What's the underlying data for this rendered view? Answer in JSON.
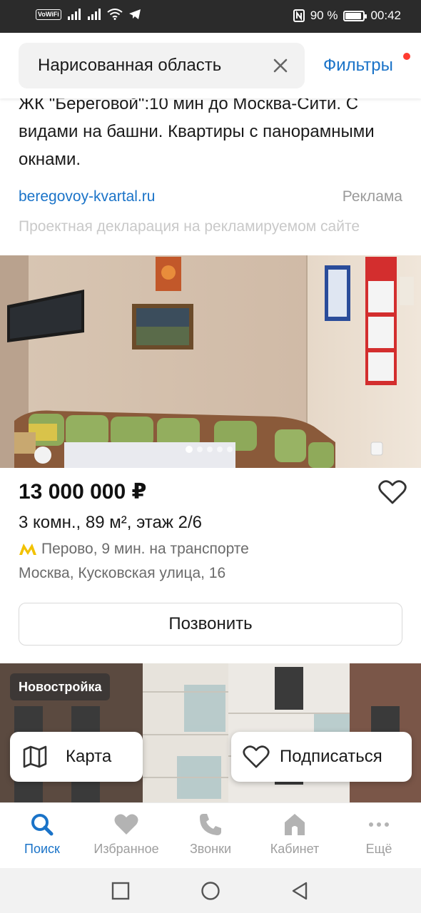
{
  "status_bar": {
    "vowifi": "VoWiFi",
    "battery": "90 %",
    "battery_level": 0.9,
    "time": "00:42"
  },
  "search": {
    "area_label": "Нарисованная область",
    "filters_label": "Фильтры",
    "clear_icon": "close-icon"
  },
  "ad": {
    "text": "ЖК \"Береговой\":10 мин до Москва-Сити. С видами на башни. Квартиры с панорамными окнами.",
    "link": "beregovoy-kvartal.ru",
    "label": "Реклама",
    "disclaimer": "Проектная декларация на рекламируемом сайте"
  },
  "listing": {
    "price": "13 000 000 ₽",
    "params": "3 комн., 89 м², этаж 2/6",
    "metro": "Перово, 9 мин. на транспорте",
    "address": "Москва, Кусковская улица, 16",
    "call_label": "Позвонить",
    "photo_count": 5,
    "active_photo": 1
  },
  "next_listing": {
    "badge": "Новостройка"
  },
  "floating": {
    "map_label": "Карта",
    "subscribe_label": "Подписаться"
  },
  "nav": {
    "items": [
      {
        "label": "Поиск",
        "icon": "search-icon",
        "active": true
      },
      {
        "label": "Избранное",
        "icon": "heart-icon",
        "active": false
      },
      {
        "label": "Звонки",
        "icon": "phone-icon",
        "active": false
      },
      {
        "label": "Кабинет",
        "icon": "home-icon",
        "active": false
      },
      {
        "label": "Ещё",
        "icon": "more-icon",
        "active": false
      }
    ]
  },
  "colors": {
    "accent": "#1a73c8",
    "metro_icon": "#f2c200",
    "filter_dot": "#ff3b30",
    "status_bar": "#2b2b2b"
  }
}
